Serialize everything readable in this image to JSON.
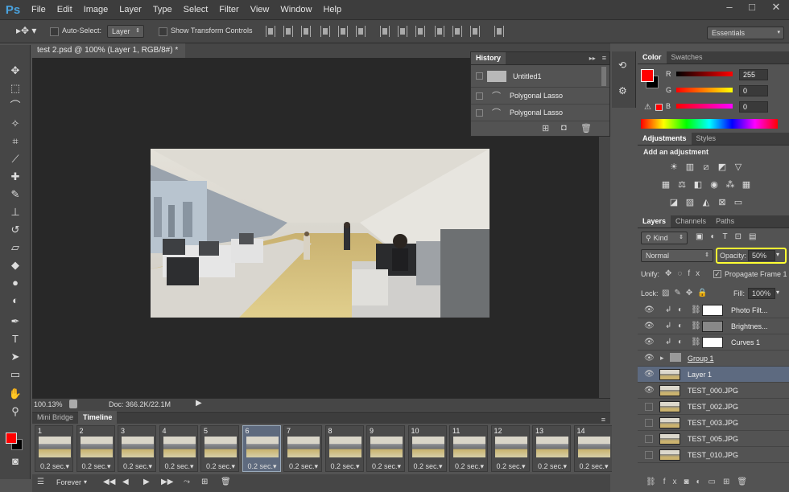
{
  "app": {
    "logo": "Ps"
  },
  "menu": [
    "File",
    "Edit",
    "Image",
    "Layer",
    "Type",
    "Select",
    "Filter",
    "View",
    "Window",
    "Help"
  ],
  "window_controls": [
    "–",
    "□",
    "✕"
  ],
  "options_bar": {
    "auto_select_label": "Auto-Select:",
    "auto_select_value": "Layer",
    "show_transform_label": "Show Transform Controls",
    "workspace": "Essentials"
  },
  "document": {
    "tab_title": "test 2.psd @ 100% (Layer 1, RGB/8#) *",
    "zoom": "100.13%",
    "doc_size": "Doc: 366.2K/22.1M"
  },
  "history": {
    "tab": "History",
    "items": [
      {
        "label": "Untitled1"
      },
      {
        "label": "Polygonal Lasso"
      },
      {
        "label": "Polygonal Lasso"
      }
    ]
  },
  "color": {
    "tabs": [
      "Color",
      "Swatches"
    ],
    "channels": [
      {
        "label": "R",
        "value": "255"
      },
      {
        "label": "G",
        "value": "0"
      },
      {
        "label": "B",
        "value": "0"
      }
    ],
    "foreground": "#ff0000",
    "background": "#000000"
  },
  "adjustments": {
    "tabs": [
      "Adjustments",
      "Styles"
    ],
    "heading": "Add an adjustment"
  },
  "layers": {
    "tabs": [
      "Layers",
      "Channels",
      "Paths"
    ],
    "filter_kind": "Kind",
    "blend_mode": "Normal",
    "opacity_label": "Opacity:",
    "opacity_value": "50%",
    "unify_label": "Unify:",
    "propagate_label": "Propagate Frame 1",
    "lock_label": "Lock:",
    "fill_label": "Fill:",
    "fill_value": "100%",
    "items": [
      {
        "name": "Photo Filt...",
        "visible": true
      },
      {
        "name": "Brightnes...",
        "visible": true
      },
      {
        "name": "Curves 1",
        "visible": true
      },
      {
        "name": "Group 1",
        "visible": true
      },
      {
        "name": "Layer 1",
        "visible": true,
        "selected": true
      },
      {
        "name": "TEST_000.JPG",
        "visible": true
      },
      {
        "name": "TEST_002.JPG",
        "visible": false
      },
      {
        "name": "TEST_003.JPG",
        "visible": false
      },
      {
        "name": "TEST_005.JPG",
        "visible": false
      },
      {
        "name": "TEST_010.JPG",
        "visible": false
      }
    ]
  },
  "timeline": {
    "tabs": [
      "Mini Bridge",
      "Timeline"
    ],
    "loop": "Forever",
    "frames": [
      {
        "num": "1",
        "delay": "0.2 sec.▾"
      },
      {
        "num": "2",
        "delay": "0.2 sec.▾"
      },
      {
        "num": "3",
        "delay": "0.2 sec.▾"
      },
      {
        "num": "4",
        "delay": "0.2 sec.▾"
      },
      {
        "num": "5",
        "delay": "0.2 sec.▾"
      },
      {
        "num": "6",
        "delay": "0.2 sec.▾"
      },
      {
        "num": "7",
        "delay": "0.2 sec.▾"
      },
      {
        "num": "8",
        "delay": "0.2 sec.▾"
      },
      {
        "num": "9",
        "delay": "0.2 sec.▾"
      },
      {
        "num": "10",
        "delay": "0.2 sec.▾"
      },
      {
        "num": "11",
        "delay": "0.2 sec.▾"
      },
      {
        "num": "12",
        "delay": "0.2 sec.▾"
      },
      {
        "num": "13",
        "delay": "0.2 sec.▾"
      },
      {
        "num": "14",
        "delay": "0.2 sec.▾"
      }
    ],
    "selected_frame": "6"
  }
}
